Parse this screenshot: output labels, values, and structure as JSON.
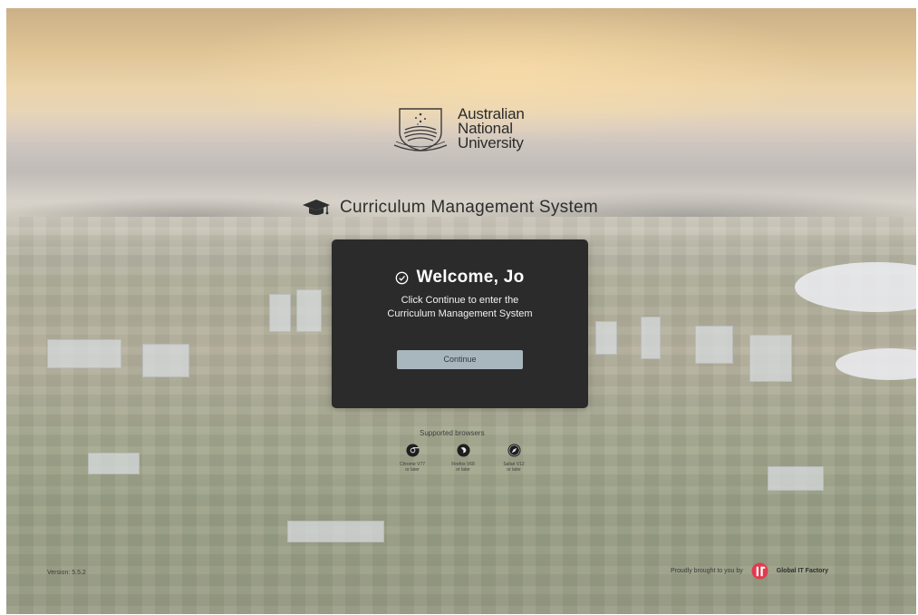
{
  "university": {
    "name_lines": [
      "Australian",
      "National",
      "University"
    ]
  },
  "system": {
    "title": "Curriculum Management System"
  },
  "welcome": {
    "heading": "Welcome, Jo",
    "message_lines": [
      "Click Continue to enter the",
      "Curriculum Management System"
    ],
    "continue_label": "Continue"
  },
  "browsers": {
    "label": "Supported browsers",
    "items": [
      {
        "name_line": "Chrome V77",
        "suffix": "or later",
        "icon": "chrome-icon"
      },
      {
        "name_line": "Firefox V68",
        "suffix": "or later",
        "icon": "firefox-icon"
      },
      {
        "name_line": "Safari V12",
        "suffix": "or later",
        "icon": "safari-icon"
      }
    ]
  },
  "footer": {
    "version": "Version: 5.5.2",
    "proudly": "Proudly brought to you by",
    "brand": "Global IT Factory"
  },
  "colors": {
    "card_bg": "#2b2b2b",
    "button_bg": "#a8b6be",
    "brand_red": "#e23a4e"
  }
}
